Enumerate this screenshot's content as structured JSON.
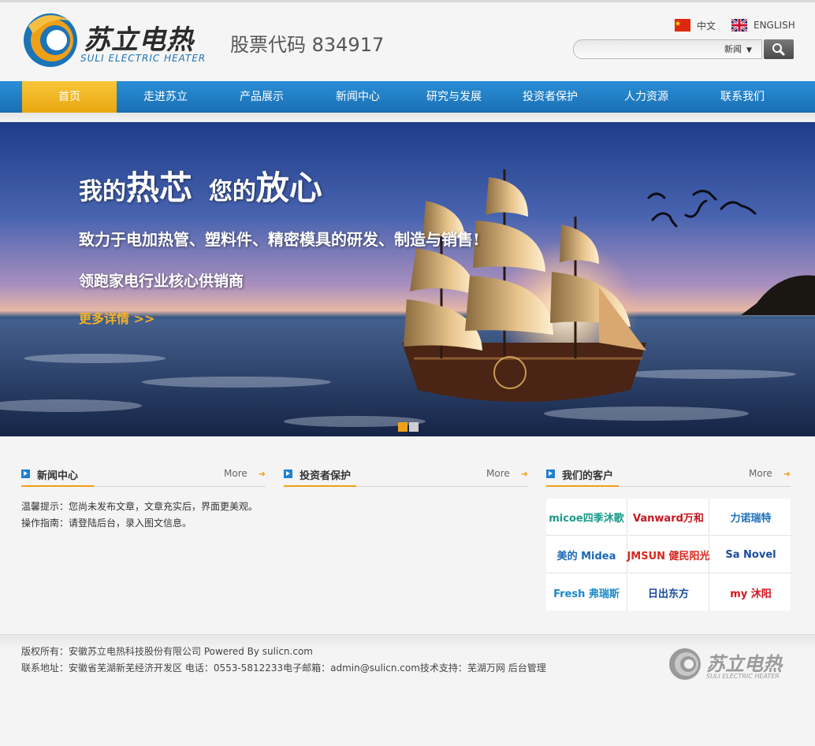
{
  "header": {
    "logo_cn": "苏立电热",
    "logo_en": "SULI ELECTRIC HEATER",
    "stock_code": "股票代码 834917",
    "lang_cn": "中文",
    "lang_en": "ENGLISH",
    "search_select": "新闻",
    "search_select_arrow": "▼"
  },
  "nav": {
    "items": [
      {
        "label": "首页"
      },
      {
        "label": "走进苏立"
      },
      {
        "label": "产品展示"
      },
      {
        "label": "新闻中心"
      },
      {
        "label": "研究与发展"
      },
      {
        "label": "投资者保护"
      },
      {
        "label": "人力资源"
      },
      {
        "label": "联系我们"
      }
    ],
    "active_index": 0
  },
  "banner": {
    "title_a": "我的",
    "title_b": "热芯",
    "title_c": "您的",
    "title_d": "放心",
    "sub1": "致力于电加热管、塑料件、精密模具的研发、制造与销售!",
    "sub2": "领跑家电行业核心供销商",
    "more": "更多详情 >>",
    "slide_count": 2,
    "active_slide": 0
  },
  "columns": {
    "news": {
      "title": "新闻中心",
      "more": "More",
      "arrow": "➜",
      "lines": [
        "温馨提示：您尚未发布文章，文章充实后，界面更美观。",
        "操作指南：请登陆后台，录入图文信息。"
      ]
    },
    "investor": {
      "title": "投资者保护",
      "more": "More",
      "arrow": "➜"
    },
    "clients": {
      "title": "我们的客户",
      "more": "More",
      "arrow": "➜",
      "logos": [
        {
          "name": "micoe四季沐歌",
          "color": "#1a9a8a"
        },
        {
          "name": "Vanward万和",
          "color": "#c8141e"
        },
        {
          "name": "力诺瑞特",
          "color": "#1c6fb8"
        },
        {
          "name": "美的 Midea",
          "color": "#1a66b8"
        },
        {
          "name": "JMSUN 健民阳光",
          "color": "#d8281e"
        },
        {
          "name": "Sa Novel",
          "color": "#1a4c9c"
        },
        {
          "name": "Fresh 弗瑞斯",
          "color": "#1a88c8"
        },
        {
          "name": "日出东方",
          "color": "#1a4c9c"
        },
        {
          "name": "my 沐阳",
          "color": "#d8141e"
        }
      ]
    }
  },
  "footer": {
    "line1_prefix": "版权所有：安徽苏立电热科技股份有限公司 Powered By ",
    "line1_link": "sulicn.com",
    "line2": "联系地址：安徽省芜湖新芜经济开发区   电话：0553-5812233电子邮箱：admin@sulicn.com技术支持：",
    "line2_link1": "芜湖万网",
    "line2_link2": "后台管理",
    "logo_cn": "苏立电热",
    "logo_en": "SULI ELECTRIC HEATER"
  },
  "colors": {
    "nav_blue": "#1f7fd0",
    "accent_orange": "#f0a018"
  }
}
